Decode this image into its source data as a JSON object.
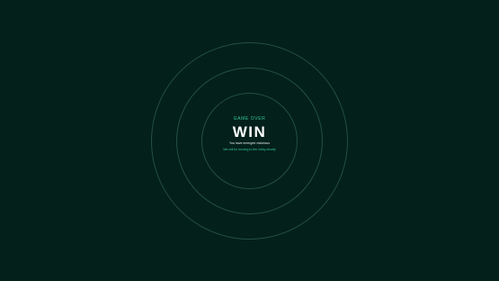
{
  "game_over": {
    "kicker": "GAME OVER",
    "result": "WIN",
    "message": "You have emerged victorious",
    "subtext": "We will be moving to the lobby shortly"
  },
  "colors": {
    "background": "#04201a",
    "accent": "#2ec79a",
    "ring": "#2f6b5a",
    "text": "#ffffff"
  }
}
